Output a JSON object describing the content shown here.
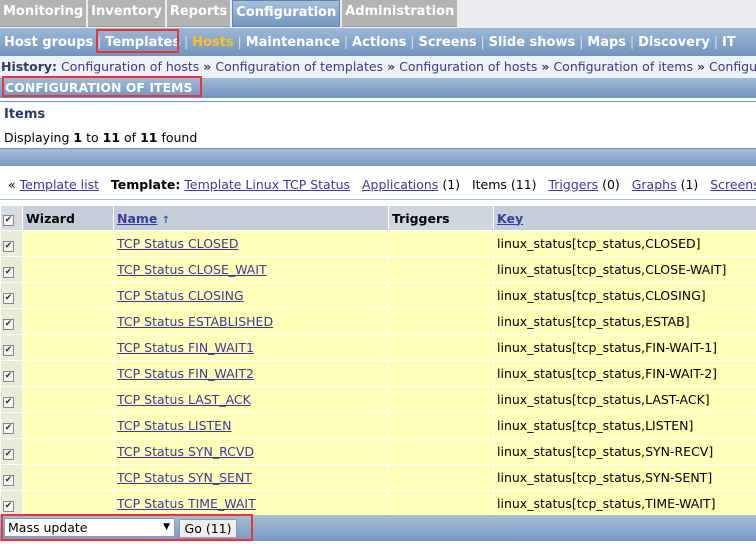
{
  "top_tabs": [
    "Monitoring",
    "Inventory",
    "Reports",
    "Configuration",
    "Administration"
  ],
  "active_top_tab": "Configuration",
  "sub_nav": [
    "Host groups",
    "Templates",
    "Hosts",
    "Maintenance",
    "Actions",
    "Screens",
    "Slide shows",
    "Maps",
    "Discovery",
    "IT"
  ],
  "active_sub_nav": "Hosts",
  "history": {
    "label": "History:",
    "items": [
      "Configuration of hosts",
      "Configuration of templates",
      "Configuration of hosts",
      "Configuration of items",
      "Configuration"
    ]
  },
  "header_title": "CONFIGURATION OF ITEMS",
  "items_section": {
    "title": "Items",
    "displaying": "Displaying",
    "from": "1",
    "to_word": "to",
    "to": "11",
    "of_word": "of",
    "total": "11",
    "found": "found"
  },
  "template_nav": {
    "back": "Template list",
    "template_label": "Template:",
    "template_name": "Template Linux TCP Status",
    "applications": "Applications",
    "applications_count": "(1)",
    "items": "Items (11)",
    "triggers": "Triggers",
    "triggers_count": "(0)",
    "graphs": "Graphs",
    "graphs_count": "(1)",
    "screens": "Screens"
  },
  "table": {
    "columns": [
      "Wizard",
      "Name",
      "Triggers",
      "Key"
    ],
    "rows": [
      {
        "name": "TCP Status CLOSED",
        "key": "linux_status[tcp_status,CLOSED]"
      },
      {
        "name": "TCP Status CLOSE_WAIT",
        "key": "linux_status[tcp_status,CLOSE-WAIT]"
      },
      {
        "name": "TCP Status CLOSING",
        "key": "linux_status[tcp_status,CLOSING]"
      },
      {
        "name": "TCP Status ESTABLISHED",
        "key": "linux_status[tcp_status,ESTAB]"
      },
      {
        "name": "TCP Status FIN_WAIT1",
        "key": "linux_status[tcp_status,FIN-WAIT-1]"
      },
      {
        "name": "TCP Status FIN_WAIT2",
        "key": "linux_status[tcp_status,FIN-WAIT-2]"
      },
      {
        "name": "TCP Status LAST_ACK",
        "key": "linux_status[tcp_status,LAST-ACK]"
      },
      {
        "name": "TCP Status LISTEN",
        "key": "linux_status[tcp_status,LISTEN]"
      },
      {
        "name": "TCP Status SYN_RCVD",
        "key": "linux_status[tcp_status,SYN-RECV]"
      },
      {
        "name": "TCP Status SYN_SENT",
        "key": "linux_status[tcp_status,SYN-SENT]"
      },
      {
        "name": "TCP Status TIME_WAIT",
        "key": "linux_status[tcp_status,TIME-WAIT]"
      }
    ]
  },
  "footer": {
    "action_select": "Mass update",
    "go_button": "Go (11)"
  }
}
